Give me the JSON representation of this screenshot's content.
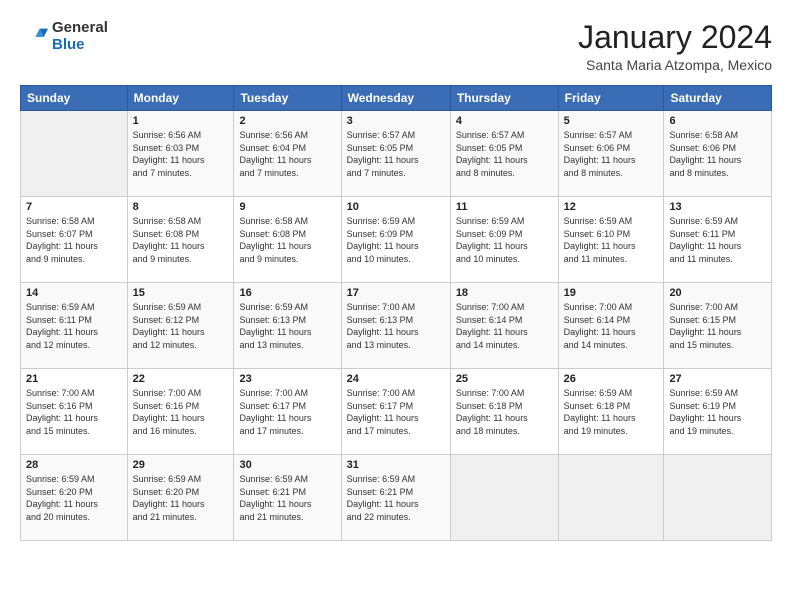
{
  "header": {
    "logo_general": "General",
    "logo_blue": "Blue",
    "month": "January 2024",
    "location": "Santa Maria Atzompa, Mexico"
  },
  "weekdays": [
    "Sunday",
    "Monday",
    "Tuesday",
    "Wednesday",
    "Thursday",
    "Friday",
    "Saturday"
  ],
  "weeks": [
    [
      {
        "day": "",
        "info": ""
      },
      {
        "day": "1",
        "info": "Sunrise: 6:56 AM\nSunset: 6:03 PM\nDaylight: 11 hours\nand 7 minutes."
      },
      {
        "day": "2",
        "info": "Sunrise: 6:56 AM\nSunset: 6:04 PM\nDaylight: 11 hours\nand 7 minutes."
      },
      {
        "day": "3",
        "info": "Sunrise: 6:57 AM\nSunset: 6:05 PM\nDaylight: 11 hours\nand 7 minutes."
      },
      {
        "day": "4",
        "info": "Sunrise: 6:57 AM\nSunset: 6:05 PM\nDaylight: 11 hours\nand 8 minutes."
      },
      {
        "day": "5",
        "info": "Sunrise: 6:57 AM\nSunset: 6:06 PM\nDaylight: 11 hours\nand 8 minutes."
      },
      {
        "day": "6",
        "info": "Sunrise: 6:58 AM\nSunset: 6:06 PM\nDaylight: 11 hours\nand 8 minutes."
      }
    ],
    [
      {
        "day": "7",
        "info": "Sunrise: 6:58 AM\nSunset: 6:07 PM\nDaylight: 11 hours\nand 9 minutes."
      },
      {
        "day": "8",
        "info": "Sunrise: 6:58 AM\nSunset: 6:08 PM\nDaylight: 11 hours\nand 9 minutes."
      },
      {
        "day": "9",
        "info": "Sunrise: 6:58 AM\nSunset: 6:08 PM\nDaylight: 11 hours\nand 9 minutes."
      },
      {
        "day": "10",
        "info": "Sunrise: 6:59 AM\nSunset: 6:09 PM\nDaylight: 11 hours\nand 10 minutes."
      },
      {
        "day": "11",
        "info": "Sunrise: 6:59 AM\nSunset: 6:09 PM\nDaylight: 11 hours\nand 10 minutes."
      },
      {
        "day": "12",
        "info": "Sunrise: 6:59 AM\nSunset: 6:10 PM\nDaylight: 11 hours\nand 11 minutes."
      },
      {
        "day": "13",
        "info": "Sunrise: 6:59 AM\nSunset: 6:11 PM\nDaylight: 11 hours\nand 11 minutes."
      }
    ],
    [
      {
        "day": "14",
        "info": "Sunrise: 6:59 AM\nSunset: 6:11 PM\nDaylight: 11 hours\nand 12 minutes."
      },
      {
        "day": "15",
        "info": "Sunrise: 6:59 AM\nSunset: 6:12 PM\nDaylight: 11 hours\nand 12 minutes."
      },
      {
        "day": "16",
        "info": "Sunrise: 6:59 AM\nSunset: 6:13 PM\nDaylight: 11 hours\nand 13 minutes."
      },
      {
        "day": "17",
        "info": "Sunrise: 7:00 AM\nSunset: 6:13 PM\nDaylight: 11 hours\nand 13 minutes."
      },
      {
        "day": "18",
        "info": "Sunrise: 7:00 AM\nSunset: 6:14 PM\nDaylight: 11 hours\nand 14 minutes."
      },
      {
        "day": "19",
        "info": "Sunrise: 7:00 AM\nSunset: 6:14 PM\nDaylight: 11 hours\nand 14 minutes."
      },
      {
        "day": "20",
        "info": "Sunrise: 7:00 AM\nSunset: 6:15 PM\nDaylight: 11 hours\nand 15 minutes."
      }
    ],
    [
      {
        "day": "21",
        "info": "Sunrise: 7:00 AM\nSunset: 6:16 PM\nDaylight: 11 hours\nand 15 minutes."
      },
      {
        "day": "22",
        "info": "Sunrise: 7:00 AM\nSunset: 6:16 PM\nDaylight: 11 hours\nand 16 minutes."
      },
      {
        "day": "23",
        "info": "Sunrise: 7:00 AM\nSunset: 6:17 PM\nDaylight: 11 hours\nand 17 minutes."
      },
      {
        "day": "24",
        "info": "Sunrise: 7:00 AM\nSunset: 6:17 PM\nDaylight: 11 hours\nand 17 minutes."
      },
      {
        "day": "25",
        "info": "Sunrise: 7:00 AM\nSunset: 6:18 PM\nDaylight: 11 hours\nand 18 minutes."
      },
      {
        "day": "26",
        "info": "Sunrise: 6:59 AM\nSunset: 6:18 PM\nDaylight: 11 hours\nand 19 minutes."
      },
      {
        "day": "27",
        "info": "Sunrise: 6:59 AM\nSunset: 6:19 PM\nDaylight: 11 hours\nand 19 minutes."
      }
    ],
    [
      {
        "day": "28",
        "info": "Sunrise: 6:59 AM\nSunset: 6:20 PM\nDaylight: 11 hours\nand 20 minutes."
      },
      {
        "day": "29",
        "info": "Sunrise: 6:59 AM\nSunset: 6:20 PM\nDaylight: 11 hours\nand 21 minutes."
      },
      {
        "day": "30",
        "info": "Sunrise: 6:59 AM\nSunset: 6:21 PM\nDaylight: 11 hours\nand 21 minutes."
      },
      {
        "day": "31",
        "info": "Sunrise: 6:59 AM\nSunset: 6:21 PM\nDaylight: 11 hours\nand 22 minutes."
      },
      {
        "day": "",
        "info": ""
      },
      {
        "day": "",
        "info": ""
      },
      {
        "day": "",
        "info": ""
      }
    ]
  ]
}
